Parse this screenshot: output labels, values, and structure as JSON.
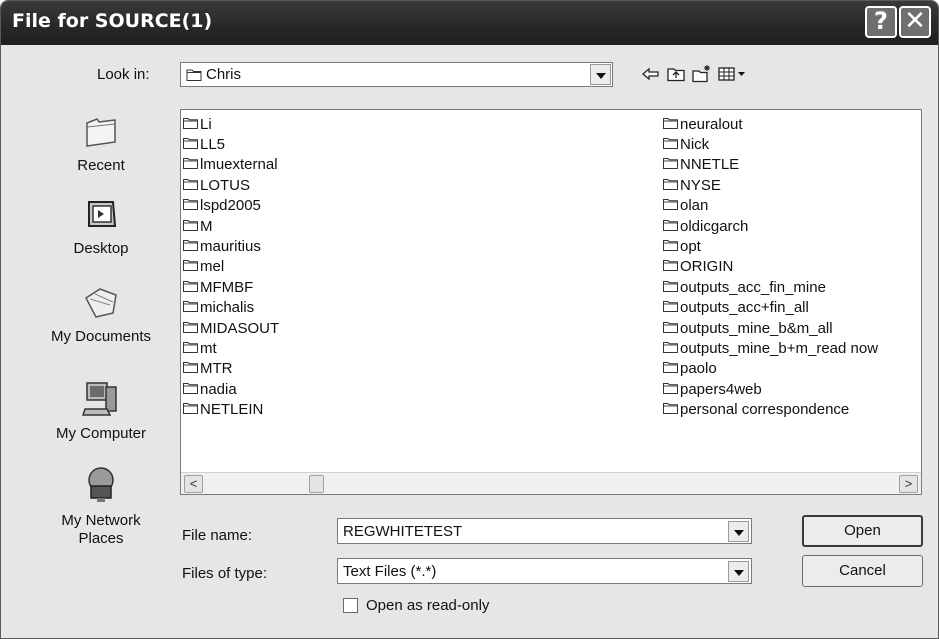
{
  "window": {
    "title": "File for SOURCE(1)",
    "help_label": "?",
    "close_label": "✕"
  },
  "lookin": {
    "label": "Look in:",
    "value": "Chris"
  },
  "toolbar": {
    "icons": [
      "back-arrow-icon",
      "up-folder-icon",
      "new-folder-icon",
      "view-menu-icon"
    ]
  },
  "places": [
    {
      "label": "Recent",
      "icon": "recent-folder-icon"
    },
    {
      "label": "Desktop",
      "icon": "desktop-icon"
    },
    {
      "label": "My Documents",
      "icon": "my-documents-icon"
    },
    {
      "label": "My Computer",
      "icon": "my-computer-icon"
    },
    {
      "label": "My Network\nPlaces",
      "icon": "network-places-icon"
    }
  ],
  "files": {
    "column1": [
      "Li",
      "LL5",
      "lmuexternal",
      "LOTUS",
      "lspd2005",
      "M",
      "mauritius",
      "mel",
      "MFMBF",
      "michalis",
      "MIDASOUT",
      "mt",
      "MTR",
      "nadia",
      "NETLEIN"
    ],
    "column2": [
      "neuralout",
      "Nick",
      "NNETLE",
      "NYSE",
      "olan",
      "oldicgarch",
      "opt",
      "ORIGIN",
      "outputs_acc_fin_mine",
      "outputs_acc+fin_all",
      "outputs_mine_b&m_all",
      "outputs_mine_b+m_read now",
      "paolo",
      "papers4web",
      "personal correspondence"
    ]
  },
  "scrollbar": {
    "left_arrow": "<",
    "right_arrow": ">"
  },
  "filename": {
    "label": "File name:",
    "value": "REGWHITETEST"
  },
  "filetype": {
    "label": "Files of type:",
    "value": "Text Files (*.*)"
  },
  "readonly": {
    "label": "Open as read-only",
    "checked": false
  },
  "buttons": {
    "open": "Open",
    "cancel": "Cancel"
  }
}
